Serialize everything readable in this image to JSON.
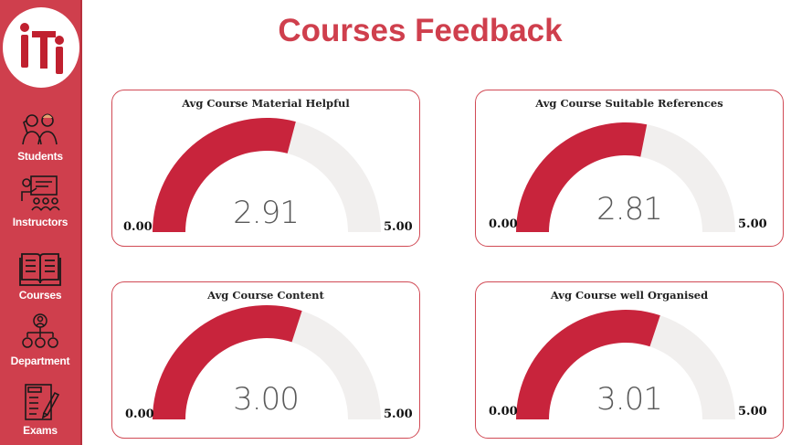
{
  "title": "Courses Feedback",
  "logo": {
    "icon": "iti-logo-icon",
    "color": "#c0202f"
  },
  "nav": [
    {
      "label": "Students",
      "icon": "students-icon"
    },
    {
      "label": "Instructors",
      "icon": "instructors-icon"
    },
    {
      "label": "Courses",
      "icon": "courses-icon"
    },
    {
      "label": "Department",
      "icon": "department-icon"
    },
    {
      "label": "Exams",
      "icon": "exams-icon"
    }
  ],
  "colors": {
    "accent": "#cf3f4d",
    "gauge_fill": "#c8243c",
    "gauge_track": "#f1efee"
  },
  "gauges": [
    {
      "title": "Avg Course Material Helpful",
      "value": 2.91,
      "display": "2.91",
      "min": 0,
      "max": 5,
      "min_label": "0.00",
      "max_label": "5.00"
    },
    {
      "title": "Avg Course Suitable References",
      "value": 2.81,
      "display": "2.81",
      "min": 0,
      "max": 5,
      "min_label": "0.00",
      "max_label": "5.00"
    },
    {
      "title": "Avg Course Content",
      "value": 3.0,
      "display": "3.00",
      "min": 0,
      "max": 5,
      "min_label": "0.00",
      "max_label": "5.00"
    },
    {
      "title": "Avg Course well Organised",
      "value": 3.01,
      "display": "3.01",
      "min": 0,
      "max": 5,
      "min_label": "0.00",
      "max_label": "5.00"
    }
  ]
}
